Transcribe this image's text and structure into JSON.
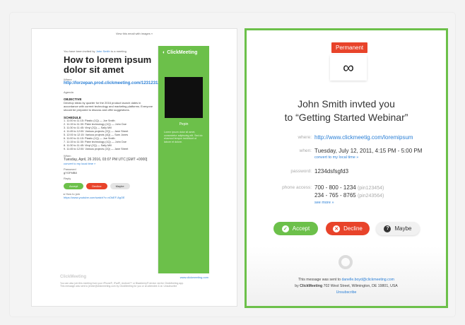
{
  "left_preview": {
    "top_link": "View this email with images »",
    "invite_note_prefix": "You have been invited by",
    "invite_note_name": "John Smith",
    "invite_note_suffix": "to a meeting",
    "title": "How to lorem ipsum dolor sit amet",
    "where_label": "Where",
    "where_link": "http://lorzepan.prod.clickmeeting.com/123123123",
    "agenda_label": "Agenda",
    "objective_label": "OBJECTIVE",
    "objective_text": "Develop ideas by quarter for the 2016 product launch dates in accordance with current technology and marketing platforms. Everyone should be prepared to discuss and offer suggestions.",
    "schedule_label": "SCHEDULE",
    "schedule": [
      "1. 11:00 to 11:15: Plastic (1Q) — Joe Smith",
      "2. 11:15 to 11:30: Plate technology (1Q) — John Doe",
      "3. 11:30 to 11:45: Vinyl (2Q) — Sally Mill",
      "4. 11:45 to 12:00: Various projects (2Q) — Jane Street",
      "5. 12:00 to 12:15: Various projects (4Q) — Sam Jones",
      "6. 11:00 to 11:15: Plastic (1Q) — Joe Smith",
      "7. 11:15 to 11:30: Plate technology (1Q) — John Doe",
      "8. 11:30 to 11:45: Vinyl (2Q) — Sally Mill",
      "9. 11:45 to 12:00: Various projects (2Q) — Jane Street"
    ],
    "when_label": "When",
    "when_value": "Tuesday, April, 26 2016, 03:07 PM UTC [GMT +0000]",
    "convert_link": "convert to my local time »",
    "password_label": "Password",
    "password_value": "gYGFMB8",
    "reply_label": "Reply",
    "accept": "Accept",
    "decline": "Decline",
    "maybe": "Maybe",
    "how_to_join": "How to join",
    "video_link": "https://www.youtube.com/watch?v=nOkEF-8gOE",
    "side_logo": "ClickMeeting",
    "side_name": "Pepin",
    "side_text": "Lorem ipsum dolor sit amet, consectetur adipiscing elit. Sed do eiusmod tempor incididunt ut labore et dolore.",
    "footer_logo": "ClickMeeting",
    "footer_link": "www.clickmeeting.com",
    "footer_line1": "You can also join this meeting from your iPhone®, iPad®, Android™ or Blackberry® device via the ClickMeeting app.",
    "footer_line2": "This message was sent to jennie@clickmeeting.com by ClickMeeting for you or an attendee & at. Unsubscribe"
  },
  "invite": {
    "badge": "Permanent",
    "logo_glyph": "∞",
    "headline_line1": "John Smith invted you",
    "headline_line2": "to “Getting Started Webinar”",
    "where_label": "where:",
    "where_value": "http://www.clickmeetig.com/loremipsum",
    "when_label": "when:",
    "when_value": "Tuesday, July 12, 2011, 4:15 PM - 5:00 PM",
    "convert_link": "convert to my local time »",
    "password_label": "password:",
    "password_value": "1234dsfsgfd3",
    "phone_label": "phone access:",
    "phone1": "700 - 800 - 1234",
    "phone1_pin": "(pin123454)",
    "phone2": "234 - 765 - 8765",
    "phone2_pin": "(pin243564)",
    "see_more": "see more »",
    "accept_label": "Accept",
    "decline_label": "Decline",
    "maybe_label": "Maybe",
    "footer_prefix": "This message was sent to",
    "footer_email": "danelle.boyd@clickmeeting.com",
    "footer_by": "by",
    "footer_company": "ClickMeeting",
    "footer_address": "702 West Street, Wilmington, DE 19801, USA",
    "unsubscribe": "Unsubscribe"
  },
  "colors": {
    "green": "#6cc04a",
    "red": "#e8432a",
    "link": "#2a7fd6"
  }
}
